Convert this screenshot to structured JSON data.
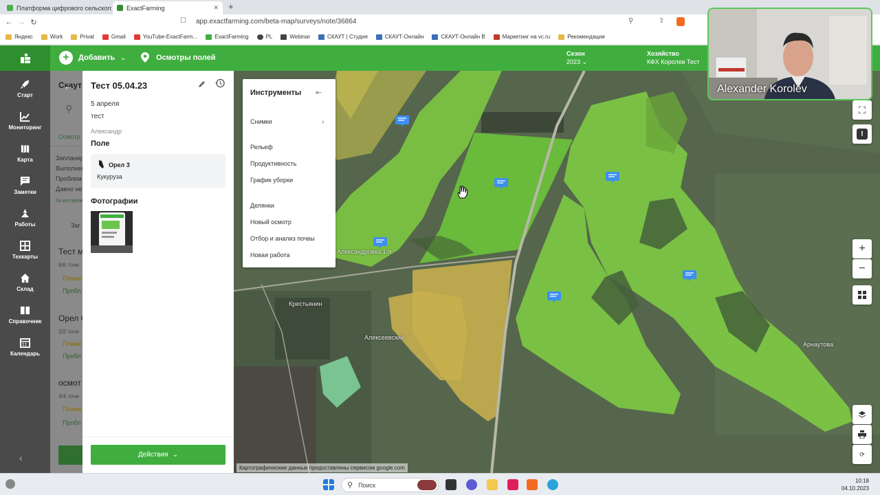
{
  "browser": {
    "tabs": [
      {
        "title": "Платформа цифрового сельского хозяйства"
      },
      {
        "title": "ExactFarming"
      }
    ],
    "new_tab": "+",
    "url": "app.exactfarming.com/beta-map/surveys/note/36864",
    "bookmarks": [
      "Яндекс",
      "Work",
      "Privat",
      "Gmail",
      "YouTube-ExactFarm...",
      "ExactFarming",
      "PL",
      "Webinar",
      "СКАУТ | Студия",
      "СКАУТ-Онлайн",
      "СКАУТ-Онлайн В",
      "Маркетинг на vc.ru",
      "Рекомендации"
    ]
  },
  "header": {
    "add_label": "Добавить",
    "surveys_label": "Осмотры полей",
    "season_label": "Сезон",
    "season_value": "2023",
    "farm_label": "Хозяйство",
    "farm_value": "КФХ Королев Тест"
  },
  "nav": [
    {
      "label": "Старт",
      "icon": "rocket-icon"
    },
    {
      "label": "Мониторинг",
      "icon": "chart-icon"
    },
    {
      "label": "Карта",
      "icon": "map-icon"
    },
    {
      "label": "Заметки",
      "icon": "notes-icon"
    },
    {
      "label": "Работы",
      "icon": "tractor-icon"
    },
    {
      "label": "Техкарты",
      "icon": "grid-icon"
    },
    {
      "label": "Склад",
      "icon": "home-icon"
    },
    {
      "label": "Справочник",
      "icon": "book-icon"
    },
    {
      "label": "Календарь",
      "icon": "calendar-icon"
    }
  ],
  "list": {
    "title": "Скаут",
    "tab": "Осмотр",
    "rows": [
      "Запланир",
      "Выполнен",
      "Проблем",
      "Давно не"
    ],
    "more": "За все врем",
    "add": "Заг",
    "items": [
      {
        "title": "Тест м",
        "sub": "6/6 точе",
        "a": "Плани",
        "b": "Пробл"
      },
      {
        "title": "Орел С",
        "sub": "2/2 точе",
        "a": "Плани",
        "b": "Пробл"
      },
      {
        "title": "осмот",
        "sub": "4/4 точе",
        "a": "Плани",
        "b": "Пробл"
      }
    ]
  },
  "detail": {
    "title": "Тест 05.04.23",
    "date": "5 апреля",
    "description": "тест",
    "author": "Александр",
    "field_heading": "Поле",
    "field_name": "Орел 3",
    "crop": "Кукуруза",
    "photos_heading": "Фотографии",
    "actions_label": "Действия"
  },
  "tools": {
    "title": "Инструменты",
    "items": [
      "Снимки",
      "Рельеф",
      "Продуктивность",
      "График уборки",
      "Делянки",
      "Новый осмотр",
      "Отбор и анализ почвы",
      "Новая работа"
    ]
  },
  "map": {
    "labels": [
      "Крестьянин",
      "Алексеевский",
      "Александровка 1-я",
      "Арнаутова"
    ],
    "attribution": "Картографические данные предоставлены сервисом google.com",
    "zoom_in": "+",
    "zoom_out": "−"
  },
  "video": {
    "name": "Alexander Korolev"
  },
  "taskbar": {
    "search_placeholder": "Поиск",
    "time": "10:18",
    "date": "04.10.2023"
  },
  "colors": {
    "brand_green": "#3fae3f",
    "nav_bg": "#4a4a4a",
    "field_green": "#7dc843",
    "field_yellow": "#c8b14e"
  }
}
